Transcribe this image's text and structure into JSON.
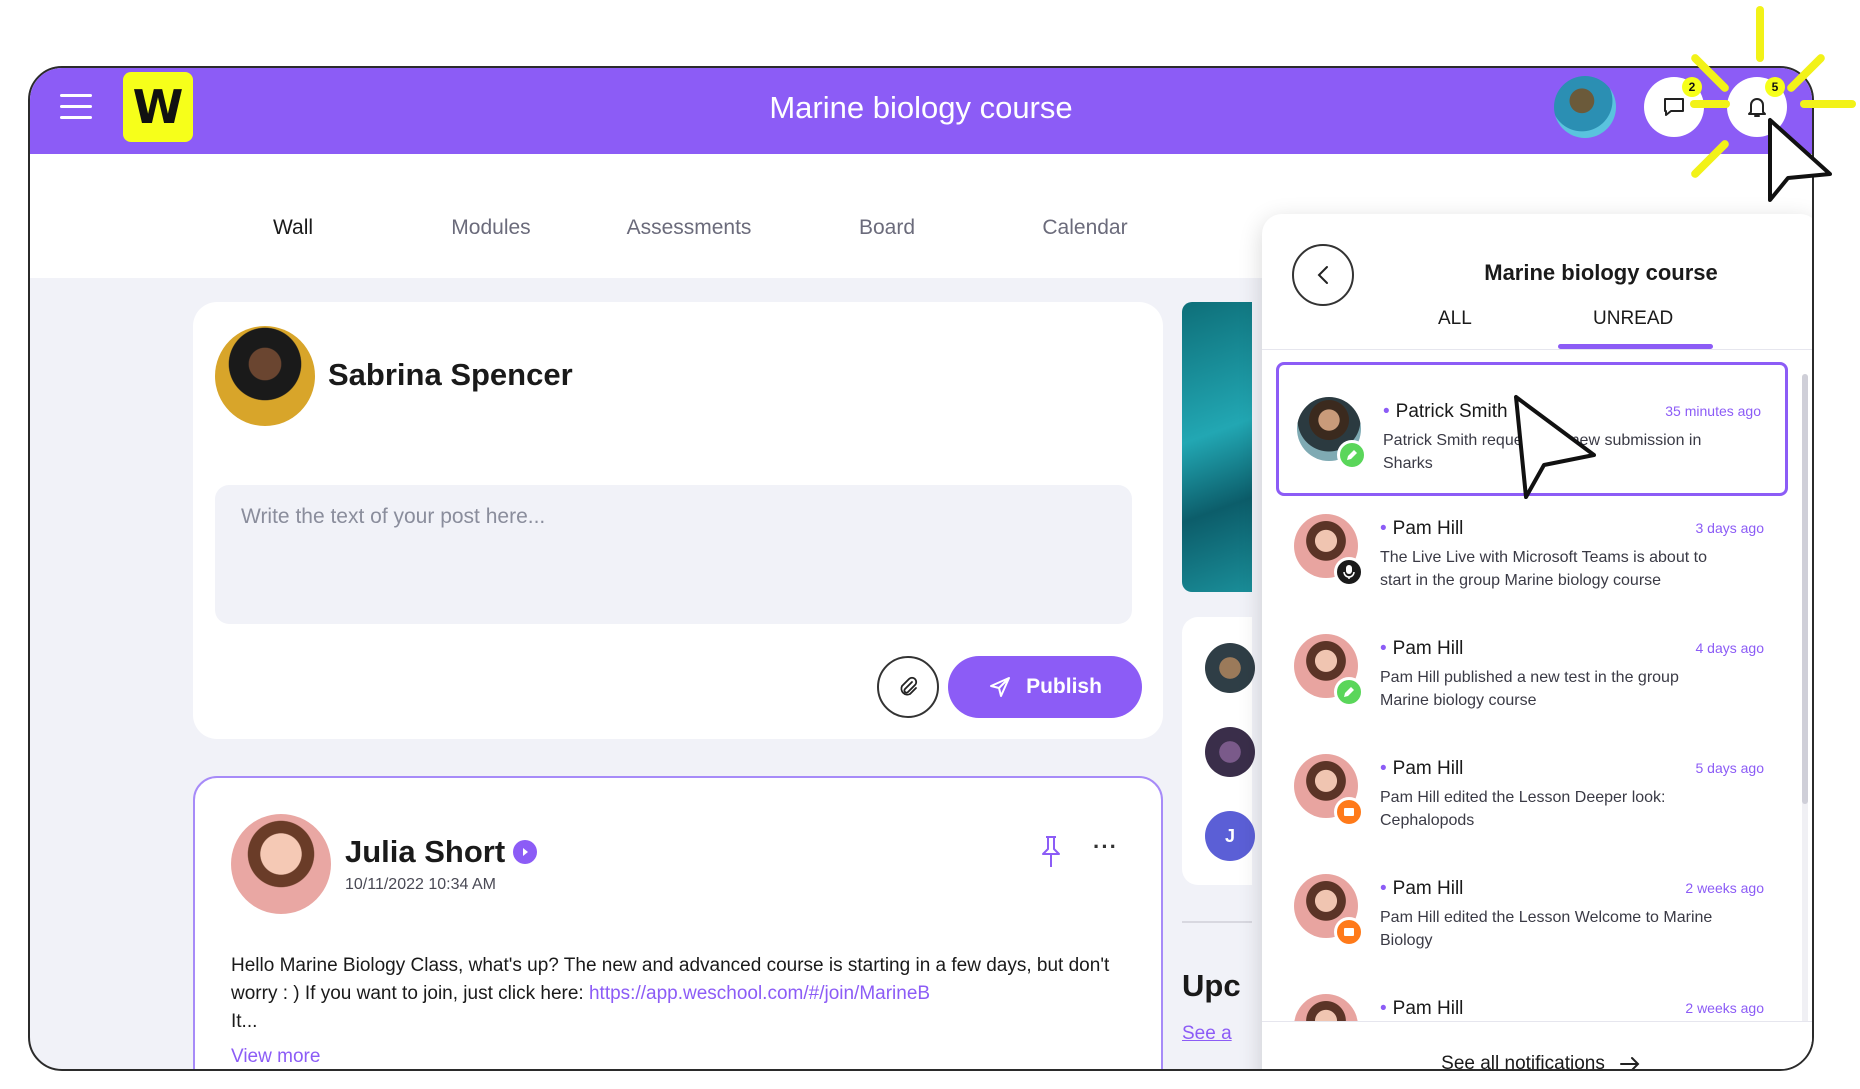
{
  "header": {
    "logo_letter": "W",
    "title": "Marine biology course",
    "chat_badge": "2",
    "notifications_badge": "5"
  },
  "tabs": [
    {
      "label": "Wall"
    },
    {
      "label": "Modules"
    },
    {
      "label": "Assessments"
    },
    {
      "label": "Board"
    },
    {
      "label": "Calendar"
    }
  ],
  "composer": {
    "author": "Sabrina Spencer",
    "placeholder": "Write the text of your post here...",
    "publish_label": "Publish"
  },
  "post": {
    "author": "Julia Short",
    "date": "10/11/2022 10:34 AM",
    "body": "Hello Marine Biology Class, what's up? The new and advanced course is starting in a few days, but don't worry : ) If you want to join, just click here: ",
    "link": "https://app.weschool.com/#/join/MarineB",
    "body_tail": "It...",
    "view_more": "View more"
  },
  "side": {
    "heading": "Upc",
    "link": "See a",
    "mini_initial": "J"
  },
  "notifications_panel": {
    "title": "Marine biology course",
    "tab_all": "ALL",
    "tab_unread": "UNREAD",
    "items": [
      {
        "name": "Patrick Smith",
        "time": "35 minutes ago",
        "text": "Patrick Smith requested a new submission in Sharks",
        "type": "pencil"
      },
      {
        "name": "Pam Hill",
        "time": "3 days ago",
        "text": "The Live Live with Microsoft Teams is about to start in the group Marine biology course",
        "type": "microphone"
      },
      {
        "name": "Pam Hill",
        "time": "4 days ago",
        "text": "Pam Hill published a new test in the group Marine biology course",
        "type": "pencil"
      },
      {
        "name": "Pam Hill",
        "time": "5 days ago",
        "text": "Pam Hill edited the Lesson Deeper look: Cephalopods",
        "type": "lesson"
      },
      {
        "name": "Pam Hill",
        "time": "2 weeks ago",
        "text": "Pam Hill edited the Lesson Welcome to Marine Biology",
        "type": "lesson"
      },
      {
        "name": "Pam Hill",
        "time": "2 weeks ago",
        "text": "",
        "type": "pencil"
      }
    ],
    "footer_label": "See all notifications"
  },
  "colors": {
    "brand_purple": "#8c5cf6",
    "logo_yellow": "#f6ff1a",
    "highlight_yellow": "#f2f218"
  }
}
